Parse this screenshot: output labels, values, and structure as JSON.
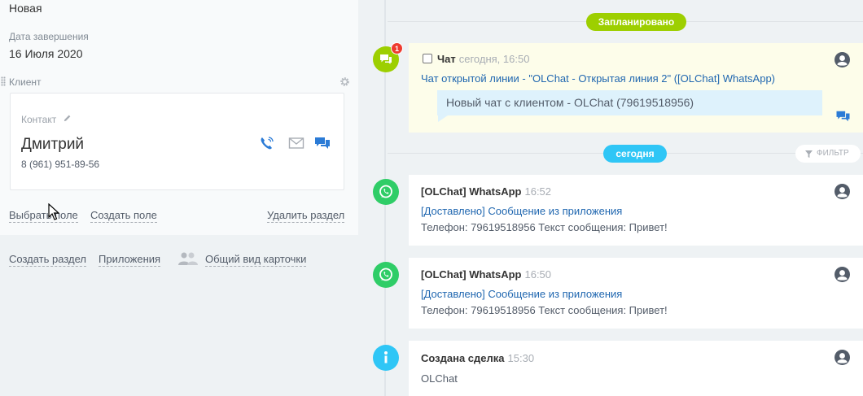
{
  "deal": {
    "status": "Новая",
    "deadline_label": "Дата завершения",
    "deadline_value": "16 Июля 2020",
    "client_section_label": "Клиент"
  },
  "contact": {
    "label": "Контакт",
    "name": "Дмитрий",
    "phone": "8 (961) 951-89-56"
  },
  "section_actions": {
    "choose_field": "Выбрать поле",
    "create_field": "Создать поле",
    "delete_section": "Удалить раздел"
  },
  "bottom_actions": {
    "create_section": "Создать раздел",
    "applications": "Приложения",
    "common_view": "Общий вид карточки"
  },
  "timeline": {
    "planned_label": "Запланировано",
    "today_label": "сегодня",
    "filter_label": "ФИЛЬТР",
    "planned_item": {
      "badge": "1",
      "title": "Чат",
      "time": "сегодня, 16:50",
      "link": "Чат открытой линии - \"OLChat - Открытая линия 2\" ([OLChat] WhatsApp)",
      "message": "Новый чат с клиентом - OLChat (79619518956)"
    },
    "items": [
      {
        "title": "[OLChat] WhatsApp",
        "time": "16:52",
        "link": "[Доставлено] Сообщение из приложения",
        "text": "Телефон: 79619518956 Текст сообщения: Привет!"
      },
      {
        "title": "[OLChat] WhatsApp",
        "time": "16:50",
        "link": "[Доставлено] Сообщение из приложения",
        "text": "Телефон: 79619518956 Текст сообщения: Привет!"
      },
      {
        "title": "Создана сделка",
        "time": "15:30",
        "text": "OLChat"
      }
    ]
  },
  "colors": {
    "planned_green": "#9dcf00",
    "today_blue": "#2fc6f6",
    "whatsapp_green": "#2fcd67",
    "info_blue": "#2fc6f6",
    "link_blue": "#2067b0",
    "badge_red": "#ee3b2f"
  },
  "icons": [
    "gear-icon",
    "pencil-icon",
    "phone-icon",
    "mail-icon",
    "chat-icon",
    "people-icon",
    "filter-icon",
    "whatsapp-icon",
    "info-icon",
    "avatar-icon",
    "mouse-cursor-icon"
  ]
}
